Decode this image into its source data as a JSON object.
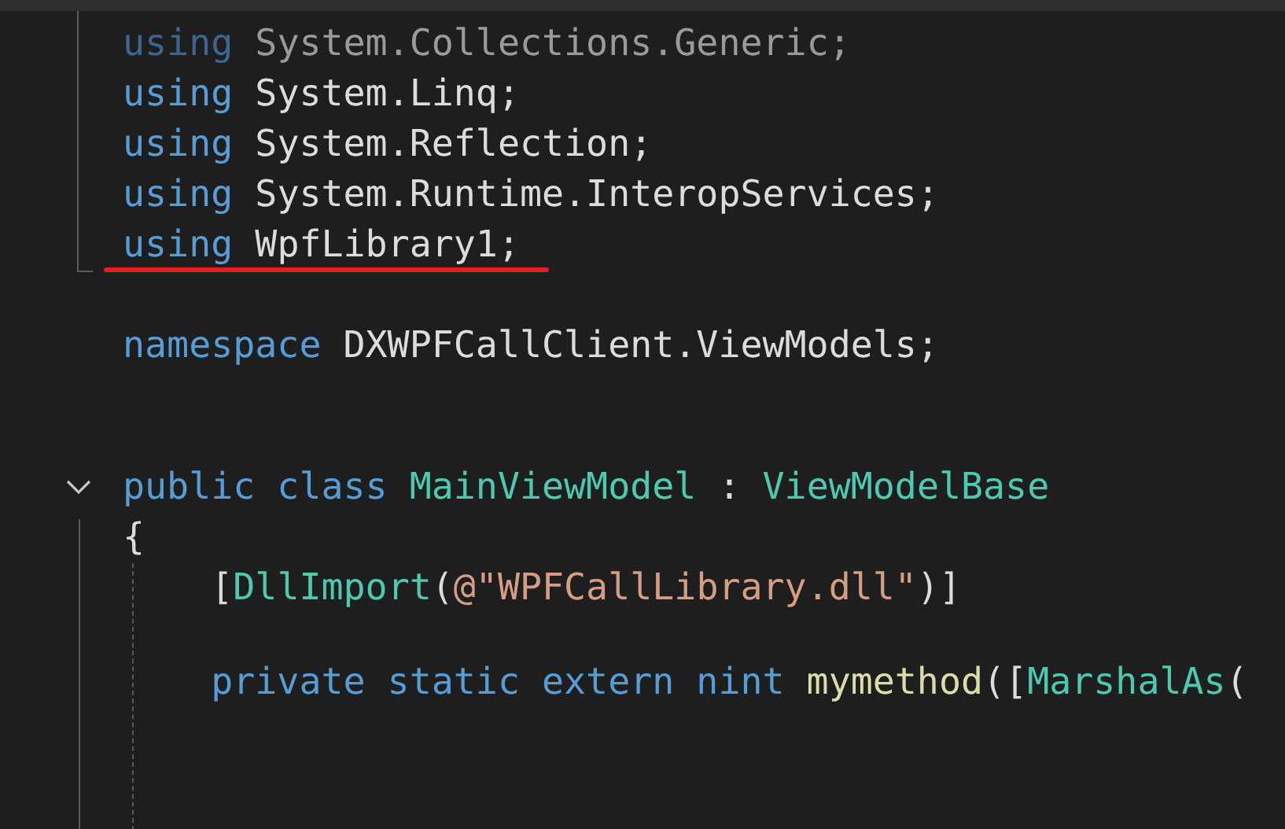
{
  "editor": {
    "blocks": [
      {
        "lines": [
          {
            "dimmed": true,
            "underlined": false,
            "tokens": [
              {
                "kind": "keyword",
                "text": "using"
              },
              {
                "kind": "plain",
                "text": " System.Collections.Generic;"
              }
            ]
          },
          {
            "dimmed": false,
            "underlined": false,
            "tokens": [
              {
                "kind": "keyword",
                "text": "using"
              },
              {
                "kind": "plain",
                "text": " System.Linq;"
              }
            ]
          },
          {
            "dimmed": false,
            "underlined": false,
            "tokens": [
              {
                "kind": "keyword",
                "text": "using"
              },
              {
                "kind": "plain",
                "text": " System.Reflection;"
              }
            ]
          },
          {
            "dimmed": false,
            "underlined": false,
            "tokens": [
              {
                "kind": "keyword",
                "text": "using"
              },
              {
                "kind": "plain",
                "text": " System.Runtime.InteropServices;"
              }
            ]
          },
          {
            "dimmed": false,
            "underlined": true,
            "tokens": [
              {
                "kind": "keyword",
                "text": "using"
              },
              {
                "kind": "plain",
                "text": " WpfLibrary1;"
              }
            ]
          }
        ]
      },
      {
        "lines": [
          {
            "dimmed": false,
            "underlined": false,
            "tokens": [
              {
                "kind": "keyword",
                "text": "namespace"
              },
              {
                "kind": "plain",
                "text": " DXWPFCallClient.ViewModels;"
              }
            ]
          }
        ]
      },
      {
        "lines": [
          {
            "dimmed": false,
            "underlined": false,
            "fold": {
              "expanded": true
            },
            "tokens": [
              {
                "kind": "keyword",
                "text": "public class"
              },
              {
                "kind": "type",
                "text": " MainViewModel"
              },
              {
                "kind": "plain",
                "text": " : "
              },
              {
                "kind": "type",
                "text": "ViewModelBase"
              }
            ]
          },
          {
            "dimmed": false,
            "underlined": false,
            "tokens": [
              {
                "kind": "plain",
                "text": "{"
              }
            ]
          },
          {
            "dimmed": false,
            "underlined": false,
            "tokens": [
              {
                "kind": "plain",
                "text": "    ["
              },
              {
                "kind": "type",
                "text": "DllImport"
              },
              {
                "kind": "plain",
                "text": "("
              },
              {
                "kind": "string",
                "text": "@\"WPFCallLibrary.dll\""
              },
              {
                "kind": "plain",
                "text": ")]"
              }
            ]
          }
        ]
      },
      {
        "lines": [
          {
            "dimmed": false,
            "underlined": false,
            "tokens": [
              {
                "kind": "keyword",
                "text": "    private static extern nint"
              },
              {
                "kind": "method",
                "text": " mymethod"
              },
              {
                "kind": "plain",
                "text": "(["
              },
              {
                "kind": "type",
                "text": "MarshalAs"
              },
              {
                "kind": "plain",
                "text": "("
              }
            ]
          }
        ]
      }
    ]
  }
}
